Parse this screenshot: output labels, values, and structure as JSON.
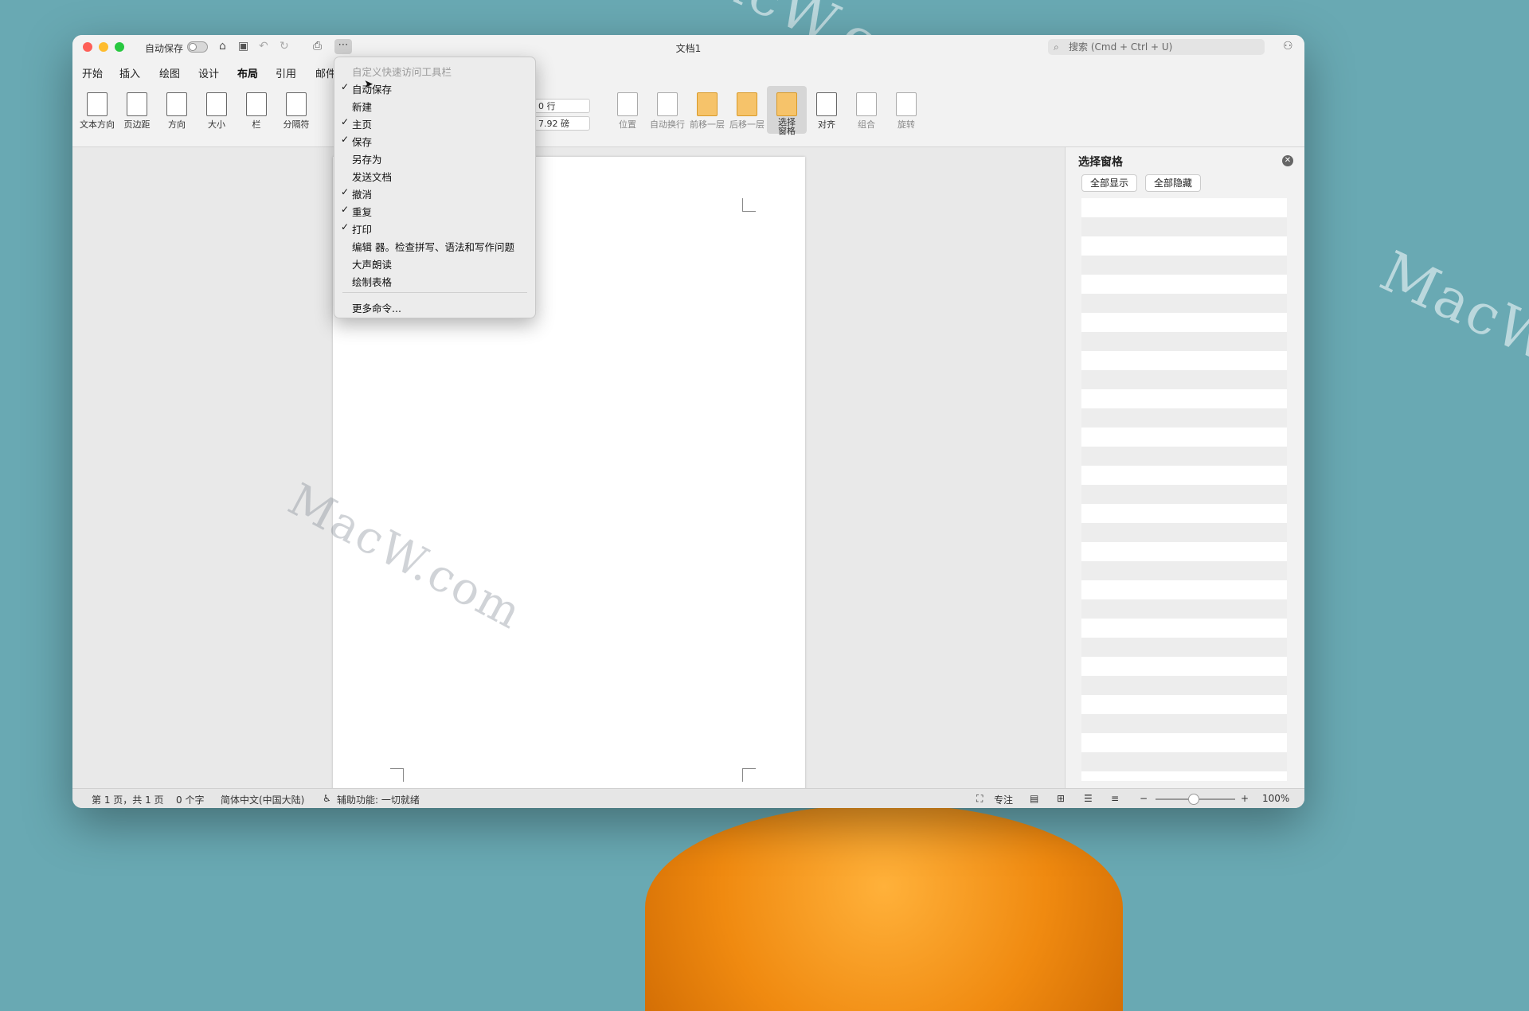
{
  "watermark": "MacW.com",
  "window": {
    "title": "文档1",
    "autosave_label": "自动保存",
    "more_label": "⋯",
    "search_placeholder": "搜索 (Cmd + Ctrl + U)",
    "share_label": "共享"
  },
  "tabs": [
    {
      "label": "开始"
    },
    {
      "label": "插入"
    },
    {
      "label": "绘图"
    },
    {
      "label": "设计"
    },
    {
      "label": "布局",
      "active": true
    },
    {
      "label": "引用"
    },
    {
      "label": "邮件"
    }
  ],
  "ribbon": {
    "left": [
      "文本方向",
      "页边距",
      "方向",
      "大小",
      "栏",
      "分隔符"
    ],
    "fields": [
      "0 行",
      "7.92 磅"
    ],
    "right": [
      "位置",
      "自动换行",
      "前移一层",
      "后移一层",
      "选择\n窗格",
      "对齐",
      "组合",
      "旋转"
    ]
  },
  "menu": {
    "header": "自定义快速访问工具栏",
    "items": [
      {
        "label": "自动保存",
        "checked": true
      },
      {
        "label": "新建",
        "checked": false
      },
      {
        "label": "主页",
        "checked": true
      },
      {
        "label": "保存",
        "checked": true
      },
      {
        "label": "另存为",
        "checked": false
      },
      {
        "label": "发送文档",
        "checked": false
      },
      {
        "label": "撤消",
        "checked": true
      },
      {
        "label": "重复",
        "checked": true
      },
      {
        "label": "打印",
        "checked": true
      },
      {
        "label": "编辑 器。检查拼写、语法和写作问题",
        "checked": false
      },
      {
        "label": "大声朗读",
        "checked": false
      },
      {
        "label": "绘制表格",
        "checked": false
      }
    ],
    "more": "更多命令..."
  },
  "selection_pane": {
    "title": "选择窗格",
    "show_all": "全部显示",
    "hide_all": "全部隐藏"
  },
  "status": {
    "page": "第 1 页，共 1 页",
    "words": "0 个字",
    "language": "简体中文(中国大陆)",
    "accessibility": "辅助功能: 一切就绪",
    "focus": "专注",
    "zoom": "100%"
  }
}
